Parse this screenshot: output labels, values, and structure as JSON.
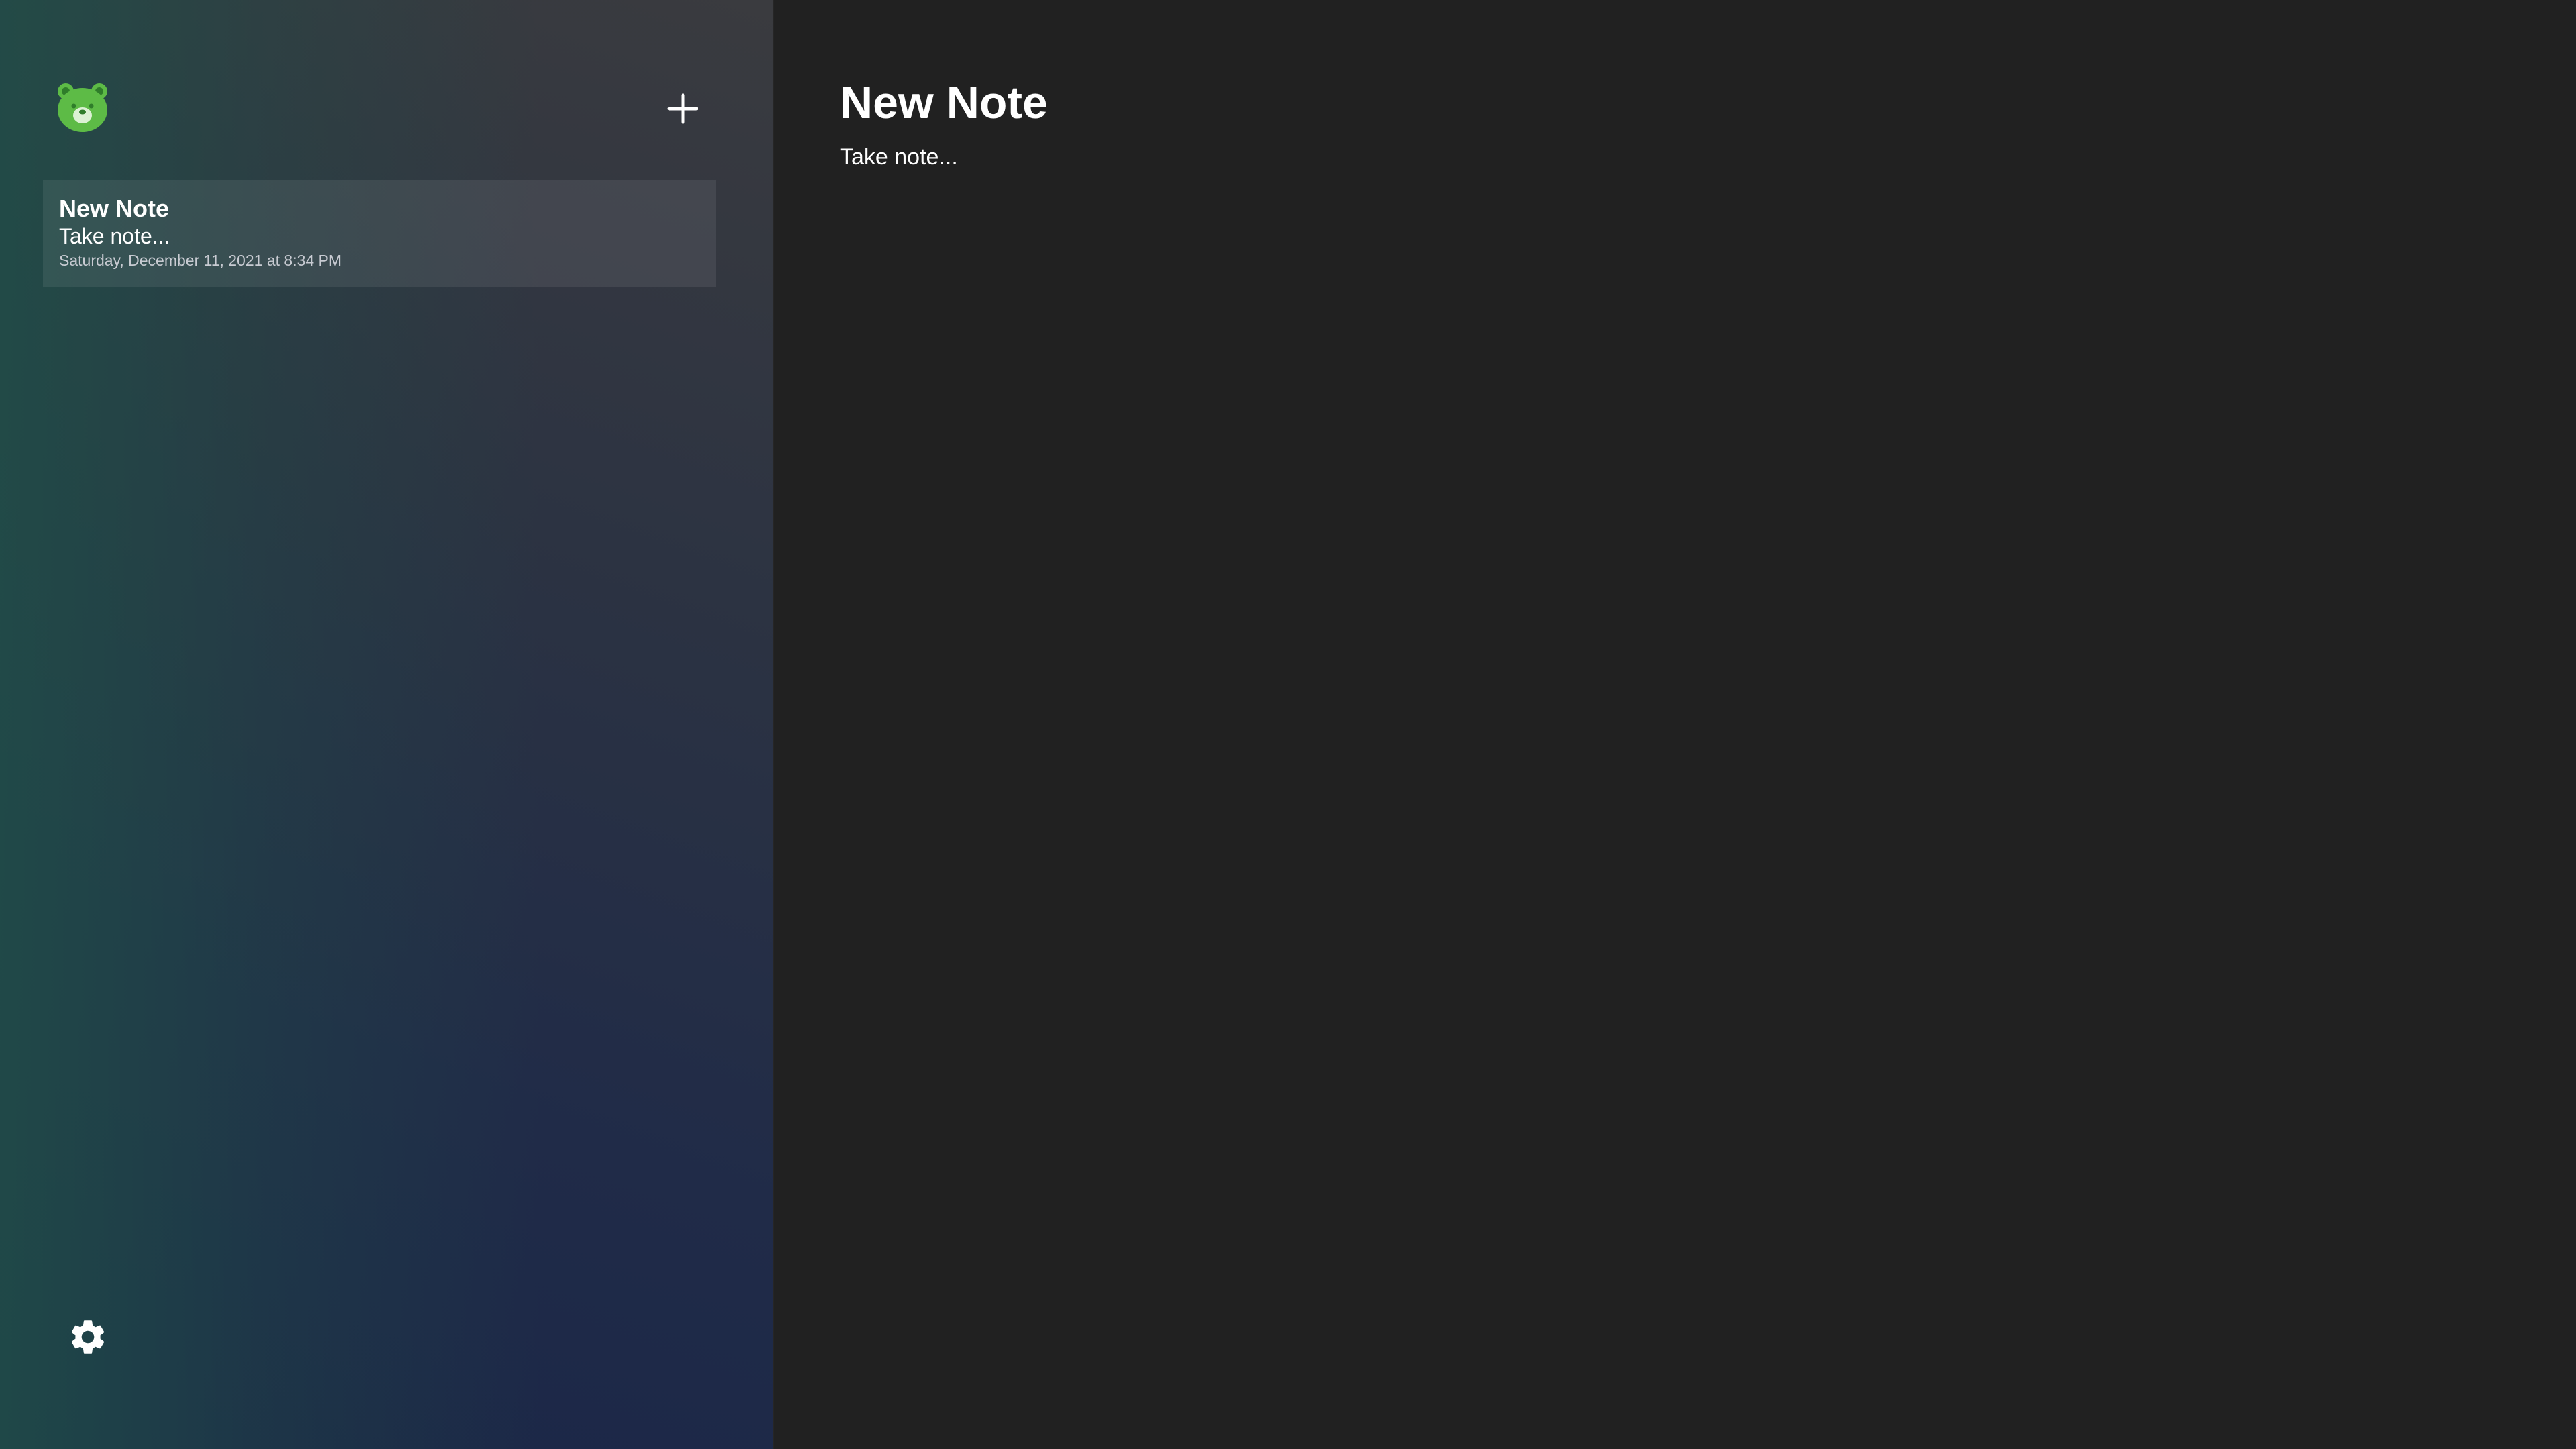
{
  "app": {
    "logo_icon": "bear-icon",
    "accent_color": "#5dbb46"
  },
  "sidebar": {
    "add_icon": "plus-icon",
    "settings_icon": "gear-icon",
    "notes": [
      {
        "title": "New Note",
        "preview": "Take note...",
        "date": "Saturday, December 11, 2021 at 8:34 PM"
      }
    ]
  },
  "editor": {
    "title": "New Note",
    "body": "Take note..."
  }
}
